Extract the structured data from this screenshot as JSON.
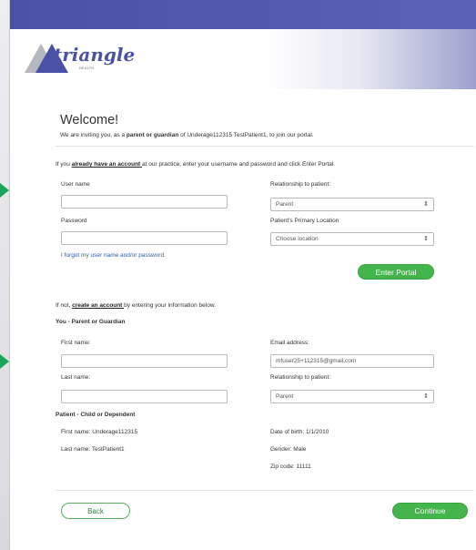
{
  "brand": {
    "name": "triangle",
    "tagline": "HEALTH",
    "colors": {
      "topbar": "#4a52a8",
      "accent": "#44b54c",
      "link": "#2a5ea8"
    }
  },
  "welcome": {
    "title": "Welcome!",
    "intro_prefix": "We are inviting you, as a ",
    "intro_role": "parent or guardian",
    "intro_suffix": " of Underage112315 TestPatient1, to join our portal."
  },
  "login": {
    "prompt_prefix": "If you ",
    "prompt_link": "already have an account ",
    "prompt_suffix": "at our practice, enter your username and password and click Enter Portal.",
    "username_label": "User name",
    "username_value": "",
    "password_label": "Password",
    "password_value": "",
    "relationship_label": "Relationship to patient:",
    "relationship_value": "Parent",
    "location_label": "Patient's Primary Location",
    "location_value": "Choose location",
    "forgot_link": "I forgot my user name and/or password.",
    "enter_button": "Enter Portal"
  },
  "signup": {
    "prompt_prefix": "If not, ",
    "prompt_link": "create an account ",
    "prompt_suffix": "by entering your information below.",
    "guardian_heading": "You - Parent or Guardian",
    "first_name_label": "First name:",
    "first_name_value": "",
    "last_name_label": "Last name:",
    "last_name_value": "",
    "email_label": "Email address:",
    "email_value": "mfuser25+112315@gmail.com",
    "relationship_label": "Relationship to patient:",
    "relationship_value": "Parent"
  },
  "patient": {
    "heading": "Patient - Child or Dependent",
    "first_name": "First name: Underage112315",
    "last_name": "Last name: TestPatient1",
    "dob": "Date of birth: 1/1/2010",
    "gender": "Gender: Male",
    "zip": "Zip code: 11111"
  },
  "footer": {
    "back_button": "Back",
    "continue_button": "Continue"
  }
}
